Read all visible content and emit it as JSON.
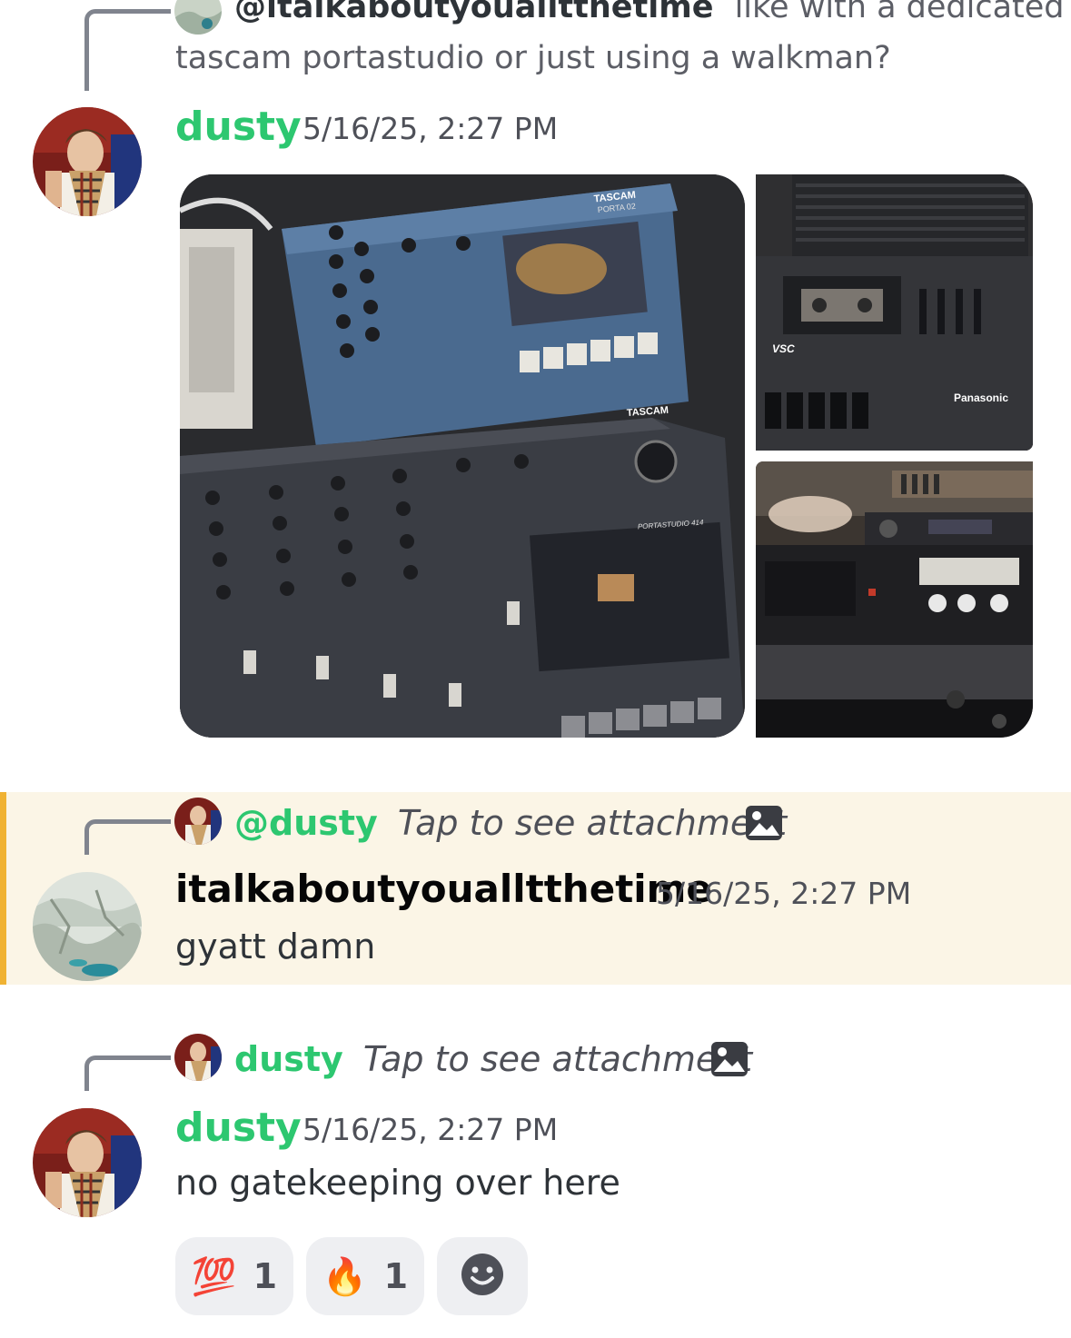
{
  "messages": [
    {
      "reply": {
        "author": "@italkaboutyoualltthetime",
        "text_line1": "like with a dedicated",
        "text_line2": "tascam portastudio or just using a walkman?"
      },
      "author": "dusty",
      "timestamp": "5/16/25, 2:27 PM",
      "attachments": [
        {
          "label": "TASCAM PORTA 02 / PORTASTUDIO 414",
          "brand1": "TASCAM",
          "model1": "PORTA 02",
          "brand2": "TASCAM",
          "model2": "PORTASTUDIO 414"
        },
        {
          "label": "Panasonic VSC cassette recorder",
          "brand": "Panasonic",
          "badge": "VSC"
        },
        {
          "label": "Cassette deck stack"
        }
      ]
    },
    {
      "reply": {
        "author": "@dusty",
        "text": "Tap to see attachment"
      },
      "author": "italkaboutyoualltthetime",
      "timestamp": "5/16/25, 2:27 PM",
      "text": "gyatt damn",
      "highlight": true
    },
    {
      "reply": {
        "author": "dusty",
        "text": "Tap to see attachment"
      },
      "author": "dusty",
      "timestamp": "5/16/25, 2:27 PM",
      "text": "no gatekeeping over here",
      "reactions": [
        {
          "emoji": "💯",
          "count": "1"
        },
        {
          "emoji": "🔥",
          "count": "1"
        },
        {
          "icon": "add-reaction-icon"
        }
      ]
    }
  ],
  "colors": {
    "accent_green": "#2dc770",
    "highlight_bg": "#fbf5e6",
    "highlight_bar": "#f0b232"
  }
}
